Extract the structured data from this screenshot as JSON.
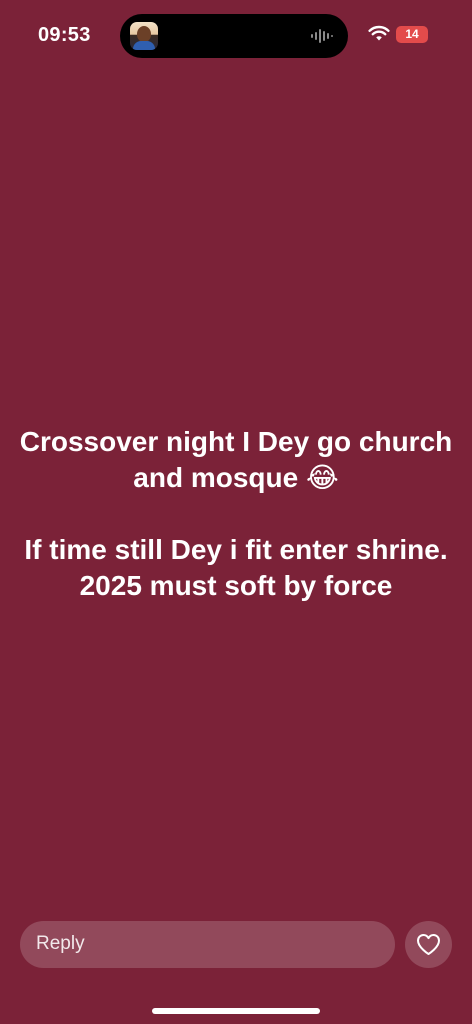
{
  "status_bar": {
    "time": "09:53",
    "battery_level": "14",
    "battery_color": "#e34b4b",
    "wifi_icon": "wifi-icon",
    "waveform_icon": "audio-waveform-icon"
  },
  "story": {
    "background_color": "#7b2238",
    "line1": "Crossover night I Dey go church",
    "line2": "and mosque 😂",
    "line3": "If time still Dey i fit enter shrine.",
    "line4": "2025 must soft by force"
  },
  "footer": {
    "reply_label": "Reply",
    "like_icon": "heart-icon"
  }
}
